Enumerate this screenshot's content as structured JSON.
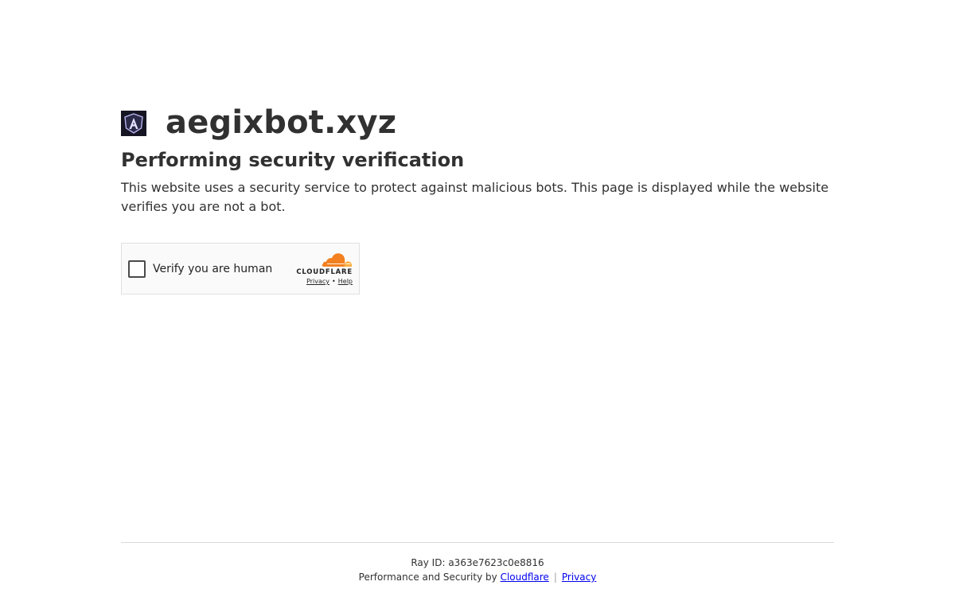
{
  "site": {
    "name": "aegixbot.xyz",
    "logo_icon": "aegix-shield-logo-icon"
  },
  "challenge": {
    "heading": "Performing security verification",
    "description": "This website uses a security service to protect against malicious bots. This page is displayed while the website verifies you are not a bot."
  },
  "widget": {
    "checkbox_label": "Verify you are human",
    "checked": false,
    "brand_wordmark": "CLOUDFLARE",
    "privacy_link": "Privacy",
    "link_separator": "•",
    "help_link": "Help",
    "brand_icon": "cloudflare-cloud-icon"
  },
  "footer": {
    "ray_id_label": "Ray ID:",
    "ray_id": "a363e7623c0e8816",
    "performance_text": "Performance and Security by",
    "cloudflare_link": "Cloudflare",
    "separator": "|",
    "privacy_link": "Privacy"
  },
  "colors": {
    "text": "#313131",
    "link": "#0000ee",
    "cloudflare_orange": "#f38020",
    "cloudflare_light_orange": "#faae40",
    "logo_background": "#151524"
  }
}
